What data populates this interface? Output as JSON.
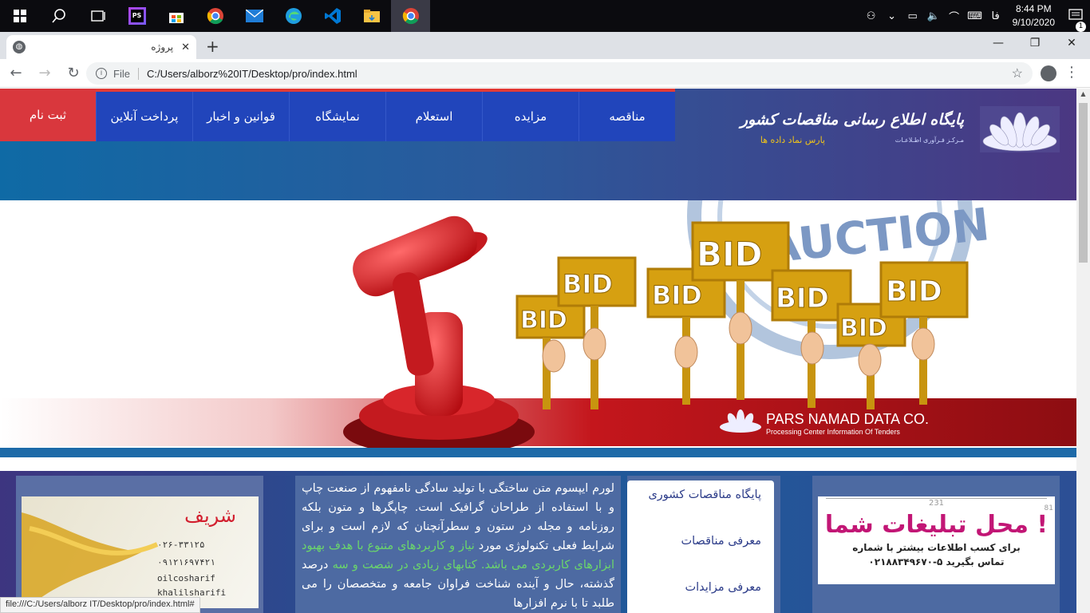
{
  "taskbar": {
    "apps": [
      {
        "name": "windows-start-icon",
        "glyph": "⊞"
      },
      {
        "name": "search-icon",
        "glyph": "⌕"
      },
      {
        "name": "task-view-icon",
        "glyph": "▣"
      },
      {
        "name": "phpstorm-icon",
        "glyph": "PS"
      },
      {
        "name": "store-icon",
        "glyph": "🛍"
      },
      {
        "name": "chrome-icon",
        "glyph": "◉"
      },
      {
        "name": "mail-icon",
        "glyph": "✉"
      },
      {
        "name": "edge-icon",
        "glyph": "e"
      },
      {
        "name": "vscode-icon",
        "glyph": "⟨⟩"
      },
      {
        "name": "file-explorer-icon",
        "glyph": "📁"
      },
      {
        "name": "chrome-active-icon",
        "glyph": "◉"
      }
    ],
    "lang": "فا",
    "time": "8:44 PM",
    "date": "9/10/2020",
    "notification_count": "1"
  },
  "browser": {
    "tab_title": "پروژه",
    "url_scheme": "File",
    "url": "C:/Users/alborz%20IT/Desktop/pro/index.html",
    "status_url": "file:///C:/Users/alborz IT/Desktop/pro/index.html#"
  },
  "header": {
    "signup_label": "ثبت نام",
    "nav": [
      "پرداخت آنلاین",
      "قوانین و اخبار",
      "نمایشگاه",
      "استعلام",
      "مزایده",
      "مناقصه"
    ],
    "brand_title": "پایگاه اطلاع رسانی مناقصات کشور",
    "brand_sub": "مـرکـز فـرآوری اطـلاعـات",
    "brand_company": "پارس نماد داده ها"
  },
  "banner": {
    "signs": [
      "BID",
      "BID",
      "BID",
      "BID",
      "BID",
      "BID"
    ],
    "stamp_text": "AUCTION",
    "company_name": "PARS NAMAD DATA CO.",
    "company_tagline": "Processing Center Information Of Tenders"
  },
  "content": {
    "ad_left": {
      "brand": "شریف",
      "phone1": "۰۲۶-۳۳۱۲۵",
      "phone2": "۰۹۱۲۱۶۹۷۴۲۱",
      "handle1": "oilcosharif",
      "handle2": "khalilsharifi"
    },
    "text_main_1": "لورم ایپسوم متن ساختگی با تولید سادگی نامفهوم از صنعت چاپ و با استفاده از طراحان گرافیک است. چاپگرها و متون بلکه روزنامه و مجله در ستون و سطرآنچنان که لازم است و برای شرایط فعلی تکنولوژی مورد",
    "text_green_1": "نیاز و کاربردهای متنوع با هدف بهبود ابزارهای کاربردی می باشد.",
    "text_green_2": "کتابهای زیادی در شصت و سه",
    "text_main_2": "درصد گذشته، حال و آینده شناخت فراوان جامعه و متخصصان را می طلبد تا با نرم افزارها",
    "links": [
      "پایگاه مناقصات کشوری",
      "معرفی مناقصات",
      "معرفی مزایدات"
    ],
    "ad_right": {
      "headline": "محل تبلیغات شما !",
      "line": "برای کسب اطلاعات بیشتر با شماره",
      "phone": "۰۲۱۸۸۳۴۹۶۷۰-۵ تماس بگیرید",
      "dim_w": "231",
      "dim_h": "81"
    }
  }
}
